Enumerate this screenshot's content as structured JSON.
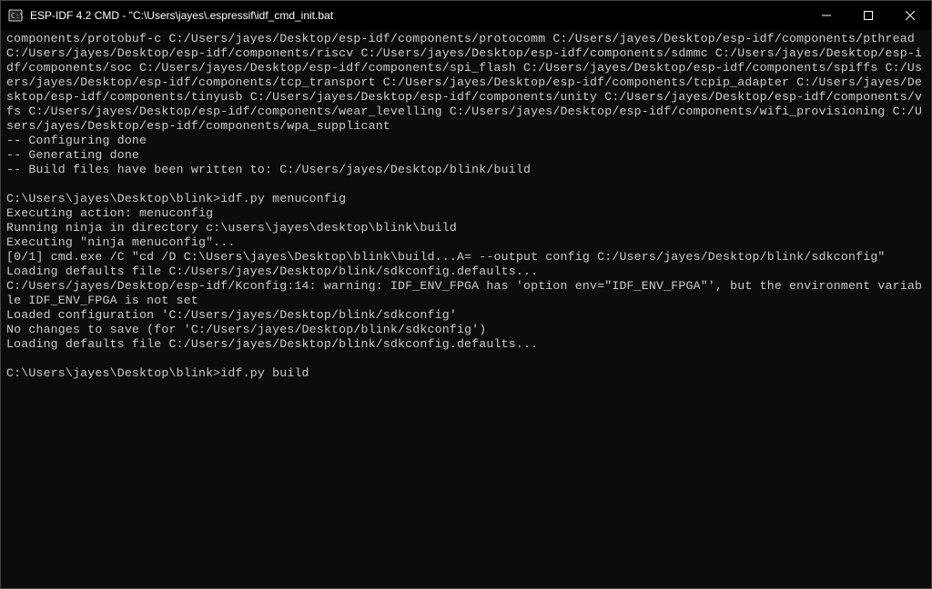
{
  "window": {
    "title": "ESP-IDF 4.2 CMD - \"C:\\Users\\jayes\\.espressif\\idf_cmd_init.bat"
  },
  "terminal": {
    "lines": [
      "components/protobuf-c C:/Users/jayes/Desktop/esp-idf/components/protocomm C:/Users/jayes/Desktop/esp-idf/components/pthread C:/Users/jayes/Desktop/esp-idf/components/riscv C:/Users/jayes/Desktop/esp-idf/components/sdmmc C:/Users/jayes/Desktop/esp-idf/components/soc C:/Users/jayes/Desktop/esp-idf/components/spi_flash C:/Users/jayes/Desktop/esp-idf/components/spiffs C:/Users/jayes/Desktop/esp-idf/components/tcp_transport C:/Users/jayes/Desktop/esp-idf/components/tcpip_adapter C:/Users/jayes/Desktop/esp-idf/components/tinyusb C:/Users/jayes/Desktop/esp-idf/components/unity C:/Users/jayes/Desktop/esp-idf/components/vfs C:/Users/jayes/Desktop/esp-idf/components/wear_levelling C:/Users/jayes/Desktop/esp-idf/components/wifi_provisioning C:/Users/jayes/Desktop/esp-idf/components/wpa_supplicant",
      "-- Configuring done",
      "-- Generating done",
      "-- Build files have been written to: C:/Users/jayes/Desktop/blink/build",
      "",
      "C:\\Users\\jayes\\Desktop\\blink>idf.py menuconfig",
      "Executing action: menuconfig",
      "Running ninja in directory c:\\users\\jayes\\desktop\\blink\\build",
      "Executing \"ninja menuconfig\"...",
      "[0/1] cmd.exe /C \"cd /D C:\\Users\\jayes\\Desktop\\blink\\build...A= --output config C:/Users/jayes/Desktop/blink/sdkconfig\"",
      "Loading defaults file C:/Users/jayes/Desktop/blink/sdkconfig.defaults...",
      "C:/Users/jayes/Desktop/esp-idf/Kconfig:14: warning: IDF_ENV_FPGA has 'option env=\"IDF_ENV_FPGA\"', but the environment variable IDF_ENV_FPGA is not set",
      "Loaded configuration 'C:/Users/jayes/Desktop/blink/sdkconfig'",
      "No changes to save (for 'C:/Users/jayes/Desktop/blink/sdkconfig')",
      "Loading defaults file C:/Users/jayes/Desktop/blink/sdkconfig.defaults...",
      "",
      "C:\\Users\\jayes\\Desktop\\blink>idf.py build"
    ]
  }
}
